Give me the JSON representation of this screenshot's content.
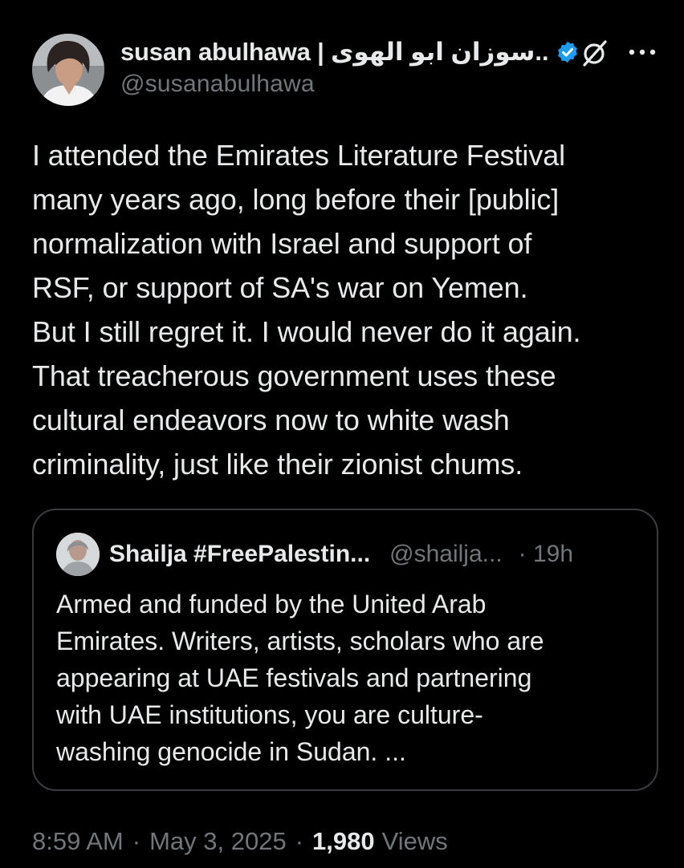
{
  "post": {
    "author": {
      "display_name": "susan abulhawa | سوزان ابو الهوى..",
      "handle": "@susanabulhawa",
      "verified": true
    },
    "text": "I attended the Emirates Literature Festival\nmany years ago, long before their [public]\nnormalization with Israel and support of\nRSF, or support of SA's war on Yemen.\nBut I still regret it. I would never do it again.\nThat treacherous government uses these\ncultural endeavors now to white wash\ncriminality, just like their zionist chums.",
    "quote": {
      "display_name": "Shailja #FreePalestin...",
      "handle": "@shailja...",
      "time": "· 19h",
      "text": "Armed and funded by the United Arab\nEmirates. Writers, artists, scholars who are\nappearing at UAE festivals and partnering\nwith UAE institutions, you are culture-\nwashing genocide in Sudan. ..."
    },
    "meta": {
      "time": "8:59 AM",
      "separator": "·",
      "date": "May 3, 2025",
      "views_count": "1,980",
      "views_label": "Views"
    }
  },
  "icons": {
    "verified": "verified-badge-icon",
    "grok": "grok-icon",
    "more": "more-options-icon"
  },
  "colors": {
    "background": "#000000",
    "text": "#e7e9ea",
    "secondary_text": "#71767b",
    "verified_blue": "#1d9bf0",
    "border": "#3a3d40"
  }
}
